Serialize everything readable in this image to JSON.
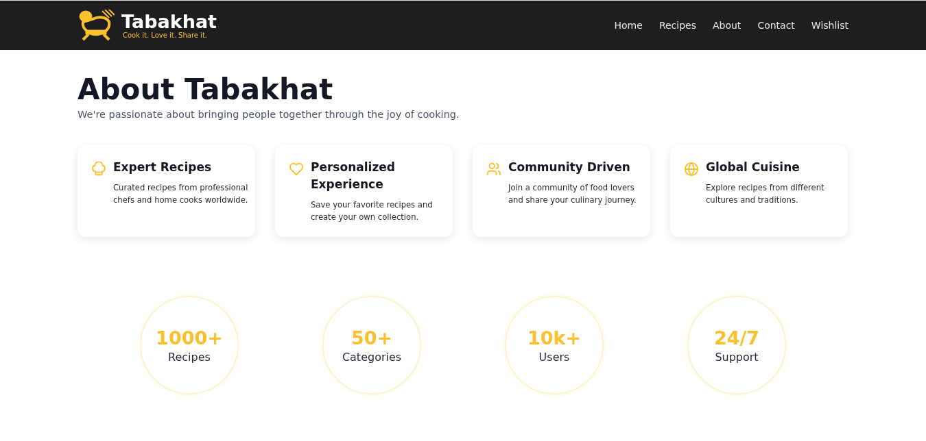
{
  "brand": {
    "name": "Tabakhat",
    "tagline": "Cook it. Love it. Share it."
  },
  "nav": [
    {
      "label": "Home"
    },
    {
      "label": "Recipes"
    },
    {
      "label": "About"
    },
    {
      "label": "Contact"
    },
    {
      "label": "Wishlist"
    }
  ],
  "heading": "About Tabakhat",
  "subtitle": "We're passionate about bringing people together through the joy of cooking.",
  "features": [
    {
      "title": "Expert Recipes",
      "text": "Curated recipes from professional chefs and home cooks worldwide."
    },
    {
      "title": "Personalized Experience",
      "text": "Save your favorite recipes and create your own collection."
    },
    {
      "title": "Community Driven",
      "text": "Join a community of food lovers and share your culinary journey."
    },
    {
      "title": "Global Cuisine",
      "text": "Explore recipes from different cultures and traditions."
    }
  ],
  "stats": [
    {
      "value": "1000+",
      "label": "Recipes"
    },
    {
      "value": "50+",
      "label": "Categories"
    },
    {
      "value": "10k+",
      "label": "Users"
    },
    {
      "value": "24/7",
      "label": "Support"
    }
  ]
}
